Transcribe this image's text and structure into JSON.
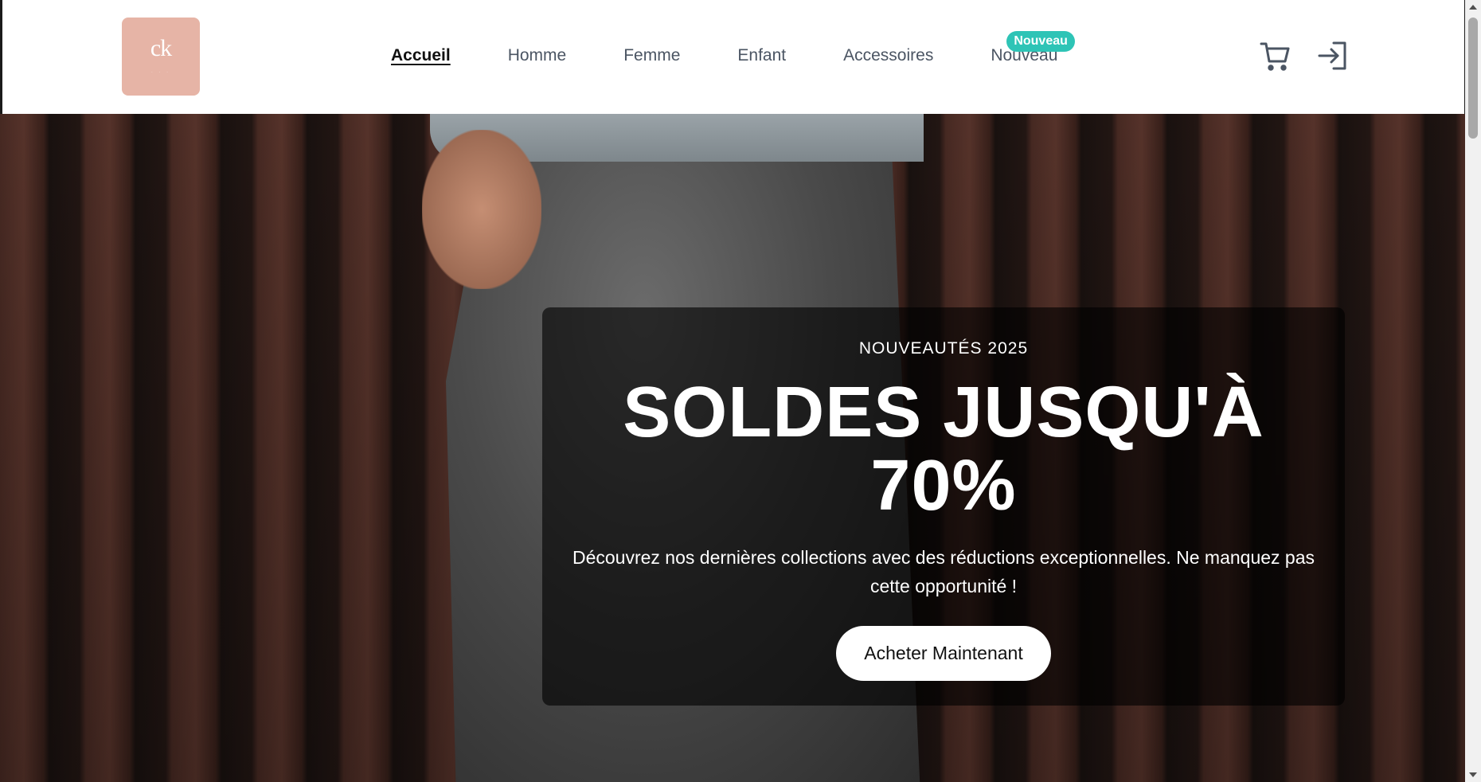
{
  "header": {
    "logo": {
      "mark": "ck",
      "sub": "· · ·"
    },
    "nav": [
      {
        "label": "Accueil",
        "active": true
      },
      {
        "label": "Homme",
        "active": false
      },
      {
        "label": "Femme",
        "active": false
      },
      {
        "label": "Enfant",
        "active": false
      },
      {
        "label": "Accessoires",
        "active": false
      },
      {
        "label": "Nouveau",
        "active": false,
        "badge": "Nouveau"
      }
    ],
    "icons": {
      "cart": "cart-icon",
      "login": "login-icon"
    }
  },
  "hero": {
    "eyebrow": "NOUVEAUTÉS 2025",
    "headline": "SOLDES JUSQU'À 70%",
    "subtext": "Découvrez nos dernières collections avec des réductions exceptionnelles. Ne manquez pas cette opportunité !",
    "cta_label": "Acheter Maintenant"
  },
  "colors": {
    "logo_bg": "#e6b4a6",
    "badge_bg": "#2ec4b6",
    "nav_active": "#111111",
    "nav_default": "#4b5563"
  }
}
